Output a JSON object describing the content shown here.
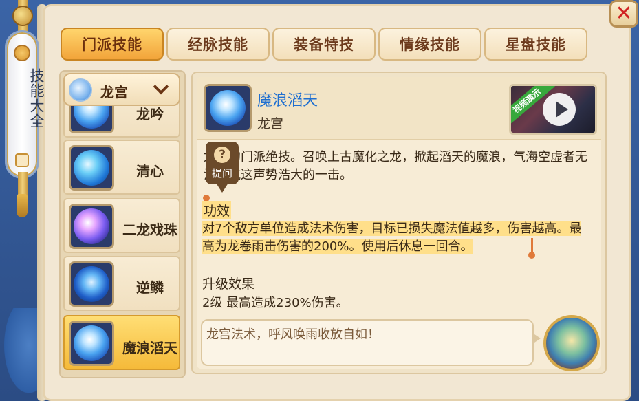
{
  "banner": {
    "title": "技能大全"
  },
  "close_icon": "close-icon",
  "tabs": [
    {
      "label": "门派技能",
      "active": true
    },
    {
      "label": "经脉技能",
      "active": false
    },
    {
      "label": "装备特技",
      "active": false
    },
    {
      "label": "情缘技能",
      "active": false
    },
    {
      "label": "星盘技能",
      "active": false
    }
  ],
  "sect_dropdown": {
    "value": "龙宫"
  },
  "skills": [
    {
      "name": "龙吟",
      "icon": "dragon-roar-icon"
    },
    {
      "name": "清心",
      "icon": "calm-heart-icon"
    },
    {
      "name": "二龙戏珠",
      "icon": "twin-dragon-pearl-icon"
    },
    {
      "name": "逆鳞",
      "icon": "reverse-scale-icon"
    },
    {
      "name": "魔浪滔天",
      "icon": "demon-wave-icon",
      "selected": true
    }
  ],
  "detail": {
    "name": "魔浪滔天",
    "sect": "龙宫",
    "video_label": "视频演示",
    "description": "龙宫的门派绝技。召唤上古魔化之龙，掀起滔天的魔浪，气海空虚者无法抵抗这声势浩大的一击。",
    "ask_label": "提问",
    "ask_symbol": "?",
    "effect_title": "功效",
    "effect_text": "对7个敌方单位造成法术伤害，目标已损失魔法值越多，伤害越高。最高为龙卷雨击伤害的200%。使用后休息一回合。",
    "upgrade_title": "升级效果",
    "upgrade_text": "2级  最高造成230%伤害。",
    "quote": "龙宫法术，呼风唤雨收放自如！"
  },
  "colors": {
    "tab_active": "#f2a43a",
    "title_blue": "#1f6fd1",
    "highlight": "#ffdf8a",
    "close_red": "#d02222"
  }
}
